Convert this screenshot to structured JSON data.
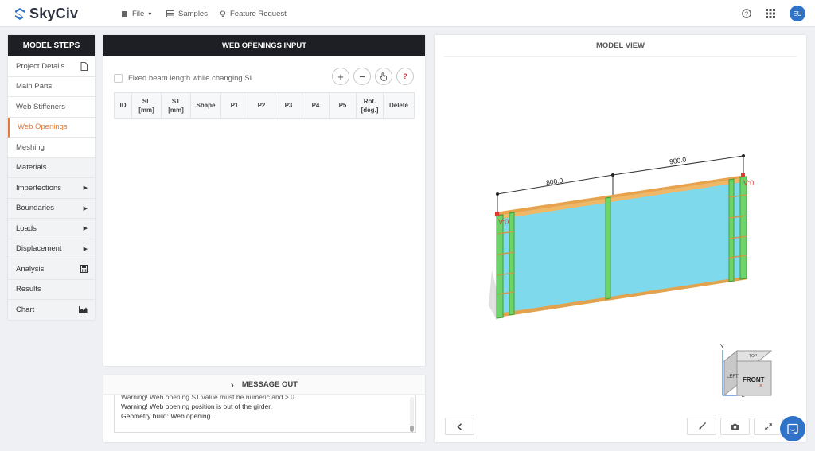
{
  "app": {
    "name": "SkyCiv"
  },
  "topbar": {
    "menu": [
      {
        "label": "File",
        "icon": "file-icon"
      },
      {
        "label": "Samples",
        "icon": "table-icon"
      },
      {
        "label": "Feature Request",
        "icon": "lightbulb-icon"
      }
    ],
    "avatar": "EU"
  },
  "steps": {
    "title": "MODEL STEPS",
    "items": [
      {
        "label": "Project Details"
      },
      {
        "label": "Main Parts"
      },
      {
        "label": "Web Stiffeners"
      },
      {
        "label": "Web Openings",
        "active": true
      },
      {
        "label": "Meshing"
      },
      {
        "label": "Materials"
      },
      {
        "label": "Imperfections"
      },
      {
        "label": "Boundaries"
      },
      {
        "label": "Loads"
      },
      {
        "label": "Displacement"
      },
      {
        "label": "Analysis"
      },
      {
        "label": "Results"
      },
      {
        "label": "Chart"
      }
    ]
  },
  "web_openings": {
    "title": "WEB OPENINGS INPUT",
    "checkbox_label": "Fixed beam length while changing SL",
    "tool_help": "?",
    "columns": [
      {
        "line1": "ID",
        "line2": ""
      },
      {
        "line1": "SL",
        "line2": "[mm]"
      },
      {
        "line1": "ST",
        "line2": "[mm]"
      },
      {
        "line1": "Shape",
        "line2": ""
      },
      {
        "line1": "P1",
        "line2": ""
      },
      {
        "line1": "P2",
        "line2": ""
      },
      {
        "line1": "P3",
        "line2": ""
      },
      {
        "line1": "P4",
        "line2": ""
      },
      {
        "line1": "P5",
        "line2": ""
      },
      {
        "line1": "Rot.",
        "line2": "[deg.]"
      },
      {
        "line1": "Delete",
        "line2": ""
      }
    ]
  },
  "message_out": {
    "title": "MESSAGE OUT",
    "lines": [
      "Warning! Web opening ST value must be numeric and > 0.",
      "Warning! Web opening position is out of the girder.",
      "Geometry build: Web opening."
    ]
  },
  "model_view": {
    "title": "MODEL VIEW",
    "dim_left": "800.0",
    "dim_right": "900.0",
    "label_left": "V:0",
    "label_right": "V:0",
    "cube": {
      "top": "TOP",
      "left": "LEFT",
      "front": "FRONT",
      "axis_y": "Y",
      "axis_z": "Z"
    }
  },
  "colors": {
    "accent": "#e07b39",
    "brand": "#2f73c9",
    "header": "#1d1f24"
  }
}
